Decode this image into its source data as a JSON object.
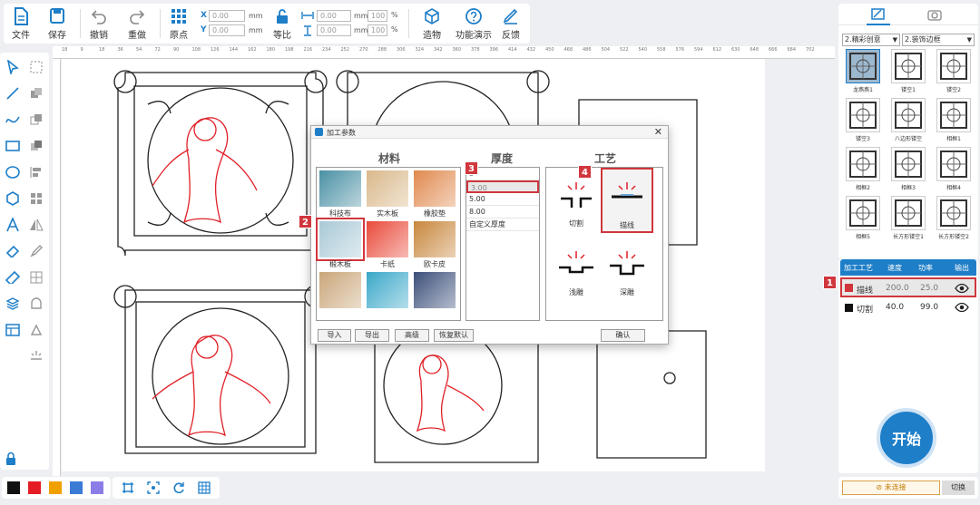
{
  "toolbar": {
    "file": "文件",
    "save": "保存",
    "undo": "撤销",
    "redo": "重做",
    "origin": "原点",
    "x_label": "X",
    "x_value": "0.00",
    "y_label": "Y",
    "y_value": "0.00",
    "unit_mm": "mm",
    "equal_ratio": "等比",
    "w_value": "0.00",
    "h_value": "0.00",
    "w_pct": "100",
    "h_pct": "100",
    "pct": "%",
    "build": "造物",
    "demo": "功能演示",
    "feedback": "反馈"
  },
  "ruler": {
    "ticks": [
      "18",
      "9",
      "18",
      "36",
      "54",
      "72",
      "90",
      "108",
      "126",
      "144",
      "162",
      "180",
      "198",
      "216",
      "234",
      "252",
      "270",
      "288",
      "306",
      "324",
      "342",
      "360",
      "378",
      "396",
      "414",
      "432",
      "450",
      "468",
      "486",
      "504",
      "522",
      "540",
      "558",
      "576",
      "594",
      "612",
      "630",
      "648",
      "666",
      "684",
      "702"
    ]
  },
  "dialog": {
    "title": "加工参数",
    "material_header": "材料",
    "thickness_header": "厚度",
    "process_header": "工艺",
    "materials": [
      {
        "name": "科技布",
        "color": "#4a90a4"
      },
      {
        "name": "实木板",
        "color": "#d9b88a"
      },
      {
        "name": "橡胶垫",
        "color": "#e0894e"
      },
      {
        "name": "椴木板",
        "color": "#a9c9d6"
      },
      {
        "name": "卡纸",
        "color": "#e94a3a"
      },
      {
        "name": "欧卡皮",
        "color": "#c8873d"
      },
      {
        "name": "",
        "color": "#caa67a"
      },
      {
        "name": "",
        "color": "#3aa8c8"
      },
      {
        "name": "",
        "color": "#3c4f7a"
      }
    ],
    "thickness_first": "3",
    "thickness": [
      "3.00",
      "5.00",
      "8.00",
      "自定义厚度"
    ],
    "processes": [
      "切割",
      "描线",
      "浅雕",
      "深雕"
    ],
    "import": "导入",
    "export": "导出",
    "advanced": "高级",
    "reset": "恢复默认",
    "confirm": "确认",
    "badges": [
      "2",
      "3",
      "4"
    ]
  },
  "right_panel": {
    "category1": "2.精彩创意",
    "category2": "2.装饰边框",
    "items": [
      "龙燕燕1",
      "镂空1",
      "镂空2",
      "镂空3",
      "八边形镂空",
      "相框1",
      "相框2",
      "相框3",
      "相框4",
      "相框5",
      "长方形镂空1",
      "长方形镂空2"
    ]
  },
  "layers": {
    "headers": [
      "加工工艺",
      "速度",
      "功率",
      "输出"
    ],
    "rows": [
      {
        "name": "描线",
        "speed": "200.0",
        "power": "25.0",
        "color": "#d0363c"
      },
      {
        "name": "切割",
        "speed": "40.0",
        "power": "99.0",
        "color": "#111111"
      }
    ],
    "badge": "1",
    "start": "开始"
  },
  "status": {
    "connection": "未连接",
    "switch": "切换"
  },
  "colors": [
    "#111111",
    "#e51c23",
    "#f0a000",
    "#3a7bd5",
    "#8a7de8"
  ],
  "accent": "#1e7ec8"
}
